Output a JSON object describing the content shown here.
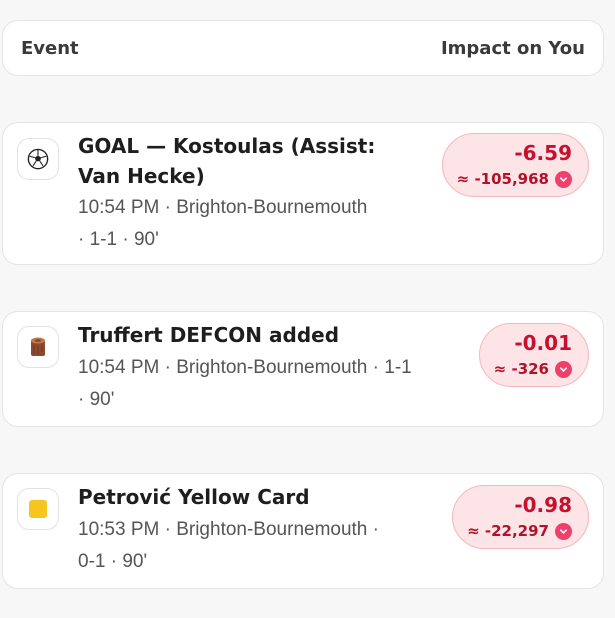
{
  "header": {
    "event_label": "Event",
    "impact_label": "Impact on You"
  },
  "events": [
    {
      "icon": "soccer-ball-icon",
      "title_line1": "GOAL — Kostoulas (Assist:",
      "title_line2": "Van Hecke)",
      "meta_line1": "10:54 PM · Brighton-Bournemouth",
      "meta_line2": "· 1-1 · 90'",
      "points": "-6.59",
      "approx": "≈ -105,968"
    },
    {
      "icon": "log-icon",
      "title_line1": "Truffert DEFCON added",
      "meta_line1": "10:54 PM · Brighton-Bournemouth · 1-1",
      "meta_line2": "· 90'",
      "points": "-0.01",
      "approx": "≈ -326"
    },
    {
      "icon": "yellow-card-icon",
      "title_line1": "Petrović Yellow Card",
      "meta_line1": "10:53 PM · Brighton-Bournemouth ·",
      "meta_line2": "0-1 · 90'",
      "points": "-0.98",
      "approx": "≈ -22,297"
    }
  ],
  "colors": {
    "negative": "#c8102e",
    "pill_bg": "#fde4e6",
    "chevron": "#ef3f6a"
  }
}
